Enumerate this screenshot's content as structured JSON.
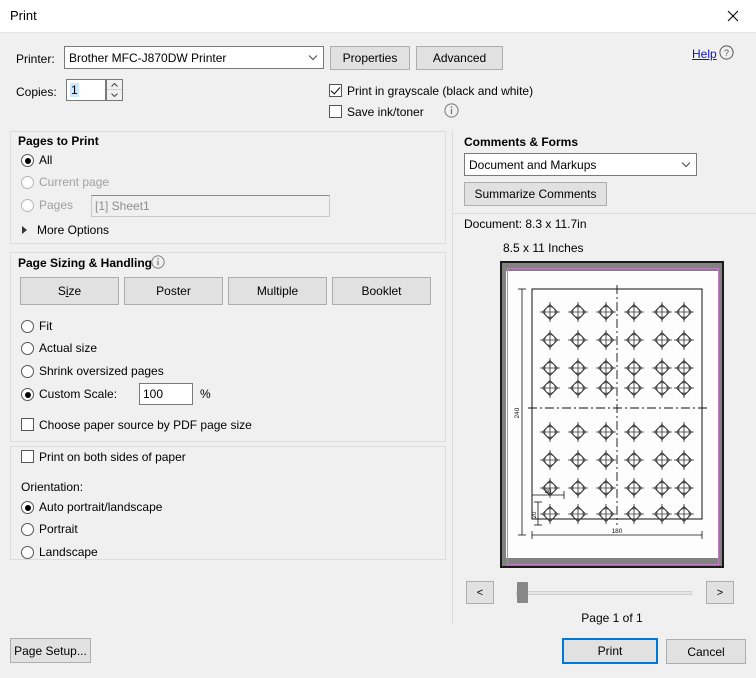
{
  "window": {
    "title": "Print",
    "close_icon": "close-icon"
  },
  "printer": {
    "label": "Printer:",
    "selected": "Brother MFC-J870DW Printer",
    "options": [
      "Brother MFC-J870DW Printer"
    ],
    "properties_label": "Properties",
    "advanced_label": "Advanced",
    "help_label": "Help",
    "help_icon": "help-circle-icon"
  },
  "copies": {
    "label": "Copies:",
    "value": "1",
    "spinner_up_icon": "spinner-up-icon",
    "spinner_down_icon": "spinner-down-icon"
  },
  "print_options": {
    "grayscale_label": "Print in grayscale (black and white)",
    "grayscale_checked": true,
    "save_ink_label": "Save ink/toner",
    "save_ink_checked": false,
    "save_ink_info_icon": "info-icon"
  },
  "pages_to_print": {
    "header": "Pages to Print",
    "options": [
      {
        "label": "All",
        "selected": true,
        "disabled": false
      },
      {
        "label": "Current page",
        "selected": false,
        "disabled": true
      },
      {
        "label": "Pages",
        "selected": false,
        "disabled": true
      }
    ],
    "pages_field_value": "[1] Sheet1",
    "more_options_label": "More Options",
    "more_options_expanded": false
  },
  "page_sizing": {
    "header": "Page Sizing & Handling",
    "header_info_icon": "info-icon",
    "buttons": [
      {
        "label": "Size",
        "accel": "i"
      },
      {
        "label": "Poster",
        "accel": ""
      },
      {
        "label": "Multiple",
        "accel": ""
      },
      {
        "label": "Booklet",
        "accel": ""
      }
    ],
    "scale_options": [
      {
        "label": "Fit",
        "selected": false
      },
      {
        "label": "Actual size",
        "selected": false
      },
      {
        "label": "Shrink oversized pages",
        "selected": false
      },
      {
        "label": "Custom Scale:",
        "selected": true
      }
    ],
    "custom_scale_value": "100",
    "percent_sign": "%",
    "paper_source_label": "Choose paper source by PDF page size",
    "paper_source_checked": false
  },
  "duplex_orientation": {
    "both_sides_label": "Print on both sides of paper",
    "both_sides_checked": false,
    "orientation_label": "Orientation:",
    "orientation_options": [
      {
        "label": "Auto portrait/landscape",
        "selected": true
      },
      {
        "label": "Portrait",
        "selected": false
      },
      {
        "label": "Landscape",
        "selected": false
      }
    ]
  },
  "comments_forms": {
    "header": "Comments & Forms",
    "selected": "Document and Markups",
    "options": [
      "Document and Markups"
    ],
    "summarize_label": "Summarize Comments"
  },
  "document_info": {
    "document_size": "Document: 8.3 x 11.7in",
    "paper_size": "8.5 x 11 Inches"
  },
  "preview": {
    "drawing": {
      "grid_columns": 6,
      "grid_rows": 8,
      "symbol": "target-crosshair-symbol",
      "dimension_width": "180",
      "dimension_height": "240",
      "dimension_offset_x": "30",
      "dimension_offset_y": "20"
    },
    "prev_button_label": "<",
    "next_button_label": ">",
    "page_label": "Page 1 of 1",
    "slider_position_percent": 0
  },
  "footer": {
    "page_setup_label": "Page Setup...",
    "print_label": "Print",
    "cancel_label": "Cancel"
  },
  "colors": {
    "accent": "#0078d7",
    "link": "#1111cc",
    "dialog_bg": "#f0f0f0",
    "margin_line": "#c27ec2"
  }
}
